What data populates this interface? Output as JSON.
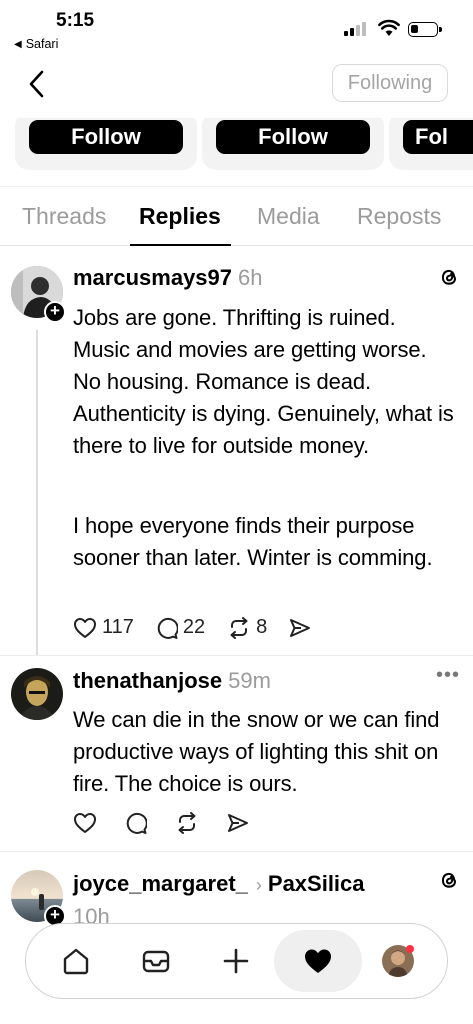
{
  "status_bar": {
    "time": "5:15",
    "back_app": "Safari"
  },
  "header": {
    "following_label": "Following"
  },
  "suggestions": {
    "follow_label": "Follow",
    "follow_label_cut": "Fol"
  },
  "tabs": [
    {
      "label": "Threads"
    },
    {
      "label": "Replies",
      "active": true
    },
    {
      "label": "Media"
    },
    {
      "label": "Reposts"
    }
  ],
  "posts": [
    {
      "username": "marcusmays97",
      "time": "6h",
      "paragraphs": [
        "Jobs are gone. Thrifting is ruined. Music and movies are getting worse. No housing. Romance is dead. Authenticity is dying. Genuinely, what is there to live for outside money.",
        "I hope everyone finds their purpose sooner than later. Winter is comming."
      ],
      "likes": "117",
      "comments": "22",
      "reposts": "8"
    },
    {
      "username": "thenathanjose",
      "time": "59m",
      "text": "We can die in the snow or we can find productive ways of lighting this shit on fire. The choice is ours."
    },
    {
      "username": "joyce_margaret_",
      "reply_to": "PaxSilica",
      "time": "10h"
    }
  ],
  "bottom_nav": {
    "items": [
      "home-icon",
      "inbox-icon",
      "create-icon",
      "activity-heart-icon",
      "profile-avatar"
    ]
  },
  "colors": {
    "muted": "#9b9b9b",
    "notification_dot": "#ff3040"
  }
}
